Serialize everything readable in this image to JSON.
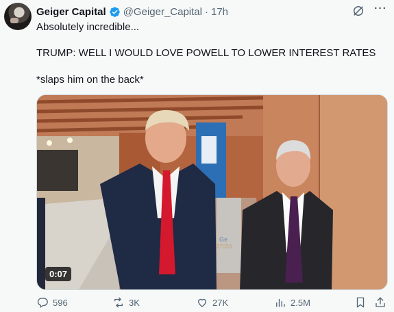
{
  "tweet": {
    "author_name": "Geiger Capital",
    "handle": "@Geiger_Capital",
    "separator": "·",
    "time": "17h",
    "lines": [
      "Absolutely incredible...",
      "TRUMP: WELL I WOULD LOVE POWELL TO LOWER INTEREST RATES",
      "*slaps him on the back*"
    ],
    "video_duration": "0:07"
  },
  "actions": {
    "replies": "596",
    "reposts": "3K",
    "likes": "27K",
    "views": "2.5M"
  },
  "colors": {
    "verified": "#1d9bf0",
    "muted": "#536471",
    "text": "#0f1419",
    "background": "#f7f9f9"
  },
  "icons": [
    "avatar",
    "verified-badge-icon",
    "grok-icon",
    "more-icon",
    "reply-icon",
    "repost-icon",
    "like-icon",
    "views-icon",
    "bookmark-icon",
    "share-icon"
  ]
}
